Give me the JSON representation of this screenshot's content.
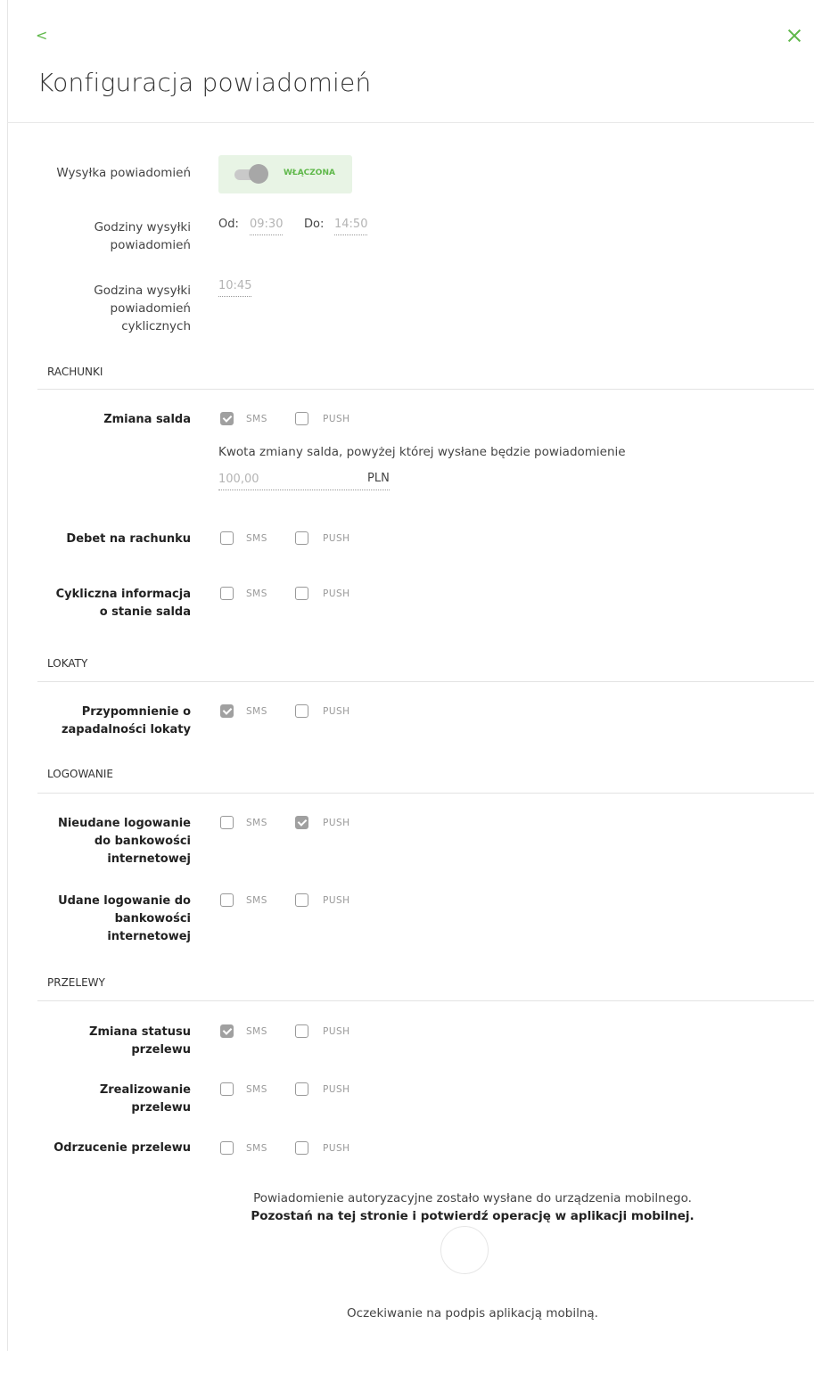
{
  "header": {
    "back_glyph": "<",
    "title": "Konfiguracja powiadomień"
  },
  "sending": {
    "label": "Wysyłka powiadomień",
    "toggle_state": "WŁĄCZONA",
    "toggle_on": true,
    "hours_label_1": "Godziny wysyłki",
    "hours_label_2": "powiadomień",
    "from_label": "Od:",
    "from_value": "09:30",
    "to_label": "Do:",
    "to_value": "14:50",
    "cyclic_label_1": "Godzina wysyłki",
    "cyclic_label_2": "powiadomień",
    "cyclic_label_3": "cyklicznych",
    "cyclic_value": "10:45"
  },
  "options": {
    "sms": "SMS",
    "push": "PUSH"
  },
  "sections": {
    "rachunki": "RACHUNKI",
    "lokaty": "LOKATY",
    "logowanie": "LOGOWANIE",
    "przelewy": "PRZELEWY"
  },
  "rows": {
    "zmiana_salda": {
      "label": "Zmiana salda",
      "sms": true,
      "push": false
    },
    "debet": {
      "label": "Debet na rachunku",
      "sms": false,
      "push": false
    },
    "cykliczna": {
      "label_1": "Cykliczna informacja",
      "label_2": "o stanie salda",
      "sms": false,
      "push": false
    },
    "przypomnienie": {
      "label_1": "Przypomnienie o",
      "label_2": "zapadalności lokaty",
      "sms": true,
      "push": false
    },
    "nieudane": {
      "label_1": "Nieudane logowanie",
      "label_2": "do bankowości",
      "label_3": "internetowej",
      "sms": false,
      "push": true
    },
    "udane": {
      "label_1": "Udane logowanie do",
      "label_2": "bankowości",
      "label_3": "internetowej",
      "sms": false,
      "push": false
    },
    "status": {
      "label_1": "Zmiana statusu",
      "label_2": "przelewu",
      "sms": true,
      "push": false
    },
    "zrealizowanie": {
      "label_1": "Zrealizowanie",
      "label_2": "przelewu",
      "sms": false,
      "push": false
    },
    "odrzucenie": {
      "label": "Odrzucenie przelewu",
      "sms": false,
      "push": false
    }
  },
  "balance_change": {
    "description": "Kwota zmiany salda, powyżej której wysłane będzie powiadomienie",
    "amount": "100,00",
    "currency": "PLN"
  },
  "footer": {
    "notice_line1": "Powiadomienie autoryzacyjne zostało wysłane do urządzenia mobilnego.",
    "notice_line2": "Pozostań na tej stronie i potwierdź operację w aplikacji mobilnej.",
    "waiting": "Oczekiwanie na podpis aplikacją mobilną."
  }
}
